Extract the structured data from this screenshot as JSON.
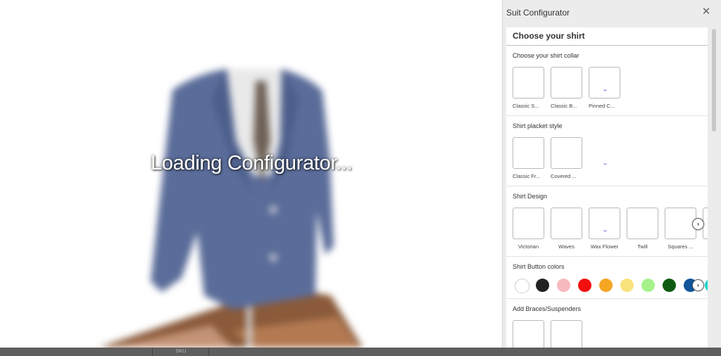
{
  "viewer": {
    "loading_text": "Loading Configurator..."
  },
  "panel": {
    "title": "Suit Configurator",
    "close_icon": "close-icon",
    "section_title": "Choose your shirt",
    "collar": {
      "title": "Choose your shirt collar",
      "options": [
        "Classic S...",
        "Classic B...",
        "Pinned C..."
      ]
    },
    "placket": {
      "title": "Shirt placket style",
      "options": [
        "Classic Fr...",
        "Covered ..."
      ]
    },
    "design": {
      "title": "Shirt Design",
      "options": [
        "Victorian",
        "Waves",
        "Wax Flower",
        "Twill",
        "Squares ..."
      ]
    },
    "buttons": {
      "title": "Shirt Button colors",
      "colors": [
        "#ffffff",
        "#222222",
        "#f7b9bd",
        "#f20f0f",
        "#f5a623",
        "#f8e27b",
        "#a5f28c",
        "#0f5a12",
        "#10549a",
        "#19d6c8"
      ]
    },
    "braces": {
      "title": "Add Braces/Suspenders"
    }
  },
  "bottom_strip": {
    "cell_label": "SKU"
  }
}
